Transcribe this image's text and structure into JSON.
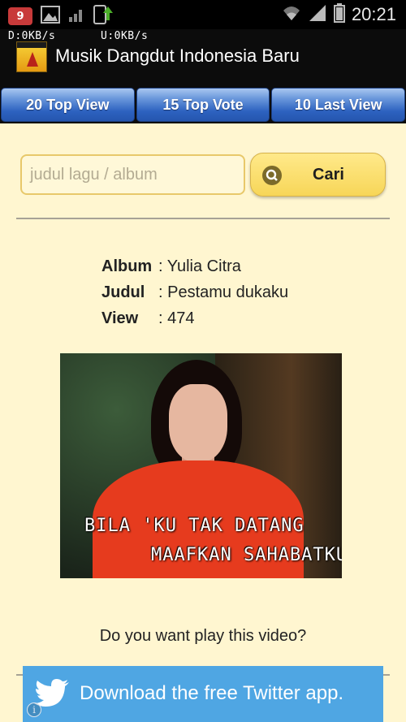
{
  "status_bar": {
    "notification_count": "9",
    "time": "20:21",
    "icons": [
      "notification-badge-icon",
      "gallery-icon",
      "signal-icon",
      "download-icon",
      "wifi-icon",
      "cell-signal-icon",
      "battery-icon"
    ]
  },
  "net_speed": {
    "download": "D:0KB/s",
    "upload": "U:0KB/s"
  },
  "app": {
    "title": "Musik Dangdut Indonesia Baru"
  },
  "tabs": [
    {
      "label": "20 Top View"
    },
    {
      "label": "15 Top Vote"
    },
    {
      "label": "10 Last View"
    }
  ],
  "search": {
    "placeholder": "judul lagu / album",
    "button_label": "Cari"
  },
  "song": {
    "album_key": "Album",
    "album_value": ": Yulia Citra",
    "title_key": "Judul",
    "title_value": ": Pestamu dukaku",
    "view_key": "View",
    "view_value": ": 474"
  },
  "thumbnail": {
    "caption_line1": "BILA 'KU TAK DATANG",
    "caption_line2": "MAAFKAN SAHABATKU"
  },
  "prompt": {
    "question": "Do you want play this video?"
  },
  "ad_banner": {
    "text": "Download the free Twitter app.",
    "color": "#4fa6e3"
  },
  "colors": {
    "background": "#fff6d0",
    "tab_blue": "#2d62c0",
    "button_yellow": "#f7d658"
  }
}
